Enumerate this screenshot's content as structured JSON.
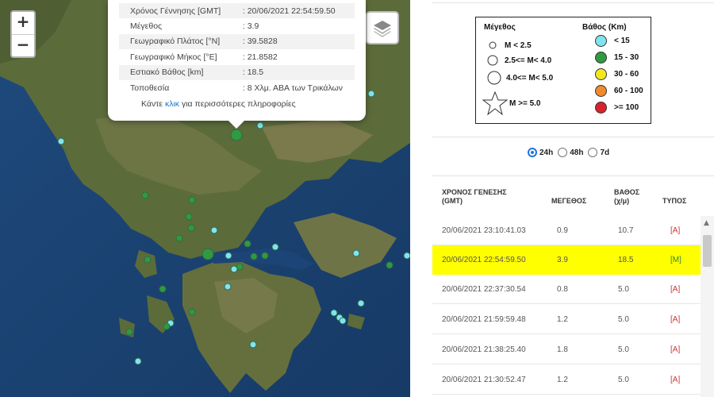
{
  "map": {
    "zoom_in": "+",
    "zoom_out": "−",
    "layers_icon": "layers-icon",
    "popup": {
      "fields": [
        {
          "label": "Χρόνος Γέννησης [GMT]",
          "value": ": 20/06/2021 22:54:59.50"
        },
        {
          "label": "Μέγεθος",
          "value": ": 3.9"
        },
        {
          "label": "Γεωγραφικό Πλάτος [°N]",
          "value": ": 39.5828"
        },
        {
          "label": "Γεωγραφικό Μήκος [°E]",
          "value": ": 21.8582"
        },
        {
          "label": "Εστιακό Βάθος [km]",
          "value": ": 18.5"
        },
        {
          "label": "Τοποθεσία",
          "value": ": 8 Χλμ. ΑΒΑ των Τρικάλων"
        }
      ],
      "more_prefix": "Κάντε ",
      "more_link": "κλικ",
      "more_suffix": " για περισσότερες πληροφορίες"
    }
  },
  "legend": {
    "size_title": "Μέγεθος",
    "depth_title": "Βάθος (Km)",
    "sizes": [
      "M < 2.5",
      "2.5<= M< 4.0",
      "4.0<= M< 5.0",
      "M >= 5.0"
    ],
    "depths": [
      {
        "label": "< 15",
        "color": "#7fe4ef"
      },
      {
        "label": "15 - 30",
        "color": "#2f9a3f"
      },
      {
        "label": "30 - 60",
        "color": "#f2e81e"
      },
      {
        "label": "60 - 100",
        "color": "#f08a2c"
      },
      {
        "label": ">= 100",
        "color": "#d8232a"
      }
    ]
  },
  "filters": {
    "options": [
      "24h",
      "48h",
      "7d"
    ],
    "selected": "24h"
  },
  "table": {
    "headers": {
      "time": "ΧΡΟΝΟΣ ΓΕΝΕΣΗΣ (GMT)",
      "magnitude": "ΜΕΓΕΘΟΣ",
      "depth": "ΒΑΘΟΣ (χ/μ)",
      "type": "ΤΥΠΟΣ"
    },
    "rows": [
      {
        "time": "20/06/2021 23:10:41.03",
        "magnitude": "0.9",
        "depth": "10.7",
        "type": "[A]"
      },
      {
        "time": "20/06/2021 22:54:59.50",
        "magnitude": "3.9",
        "depth": "18.5",
        "type": "[M]",
        "selected": true
      },
      {
        "time": "20/06/2021 22:37:30.54",
        "magnitude": "0.8",
        "depth": "5.0",
        "type": "[A]"
      },
      {
        "time": "20/06/2021 21:59:59.48",
        "magnitude": "1.2",
        "depth": "5.0",
        "type": "[A]"
      },
      {
        "time": "20/06/2021 21:38:25.40",
        "magnitude": "1.8",
        "depth": "5.0",
        "type": "[A]"
      },
      {
        "time": "20/06/2021 21:30:52.47",
        "magnitude": "1.2",
        "depth": "5.0",
        "type": "[A]"
      }
    ]
  }
}
